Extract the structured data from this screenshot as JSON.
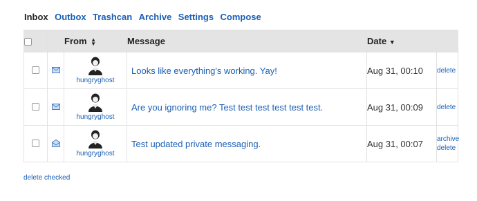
{
  "tabs": [
    {
      "label": "Inbox",
      "active": true
    },
    {
      "label": "Outbox",
      "active": false
    },
    {
      "label": "Trashcan",
      "active": false
    },
    {
      "label": "Archive",
      "active": false
    },
    {
      "label": "Settings",
      "active": false
    },
    {
      "label": "Compose",
      "active": false
    }
  ],
  "table": {
    "headers": {
      "from": "From",
      "message": "Message",
      "date": "Date"
    },
    "rows": [
      {
        "sender": "hungryghost",
        "message": "Looks like everything's working. Yay!",
        "date": "Aug 31, 00:10",
        "actions": [
          "delete"
        ],
        "read": false
      },
      {
        "sender": "hungryghost",
        "message": "Are you ignoring me? Test test test test test test.",
        "date": "Aug 31, 00:09",
        "actions": [
          "delete"
        ],
        "read": false
      },
      {
        "sender": "hungryghost",
        "message": "Test updated private messaging.",
        "date": "Aug 31, 00:07",
        "actions": [
          "archive",
          "delete"
        ],
        "read": true
      }
    ]
  },
  "footer": {
    "delete_checked": "delete checked"
  },
  "colors": {
    "link": "#1a5fb4",
    "header_bg": "#e4e4e4",
    "border": "#e2e2e2"
  },
  "icons": {
    "unread": "envelope-closed-icon",
    "read": "envelope-open-icon",
    "sort_both": "sort-updown-icon",
    "sort_desc": "sort-down-icon"
  }
}
